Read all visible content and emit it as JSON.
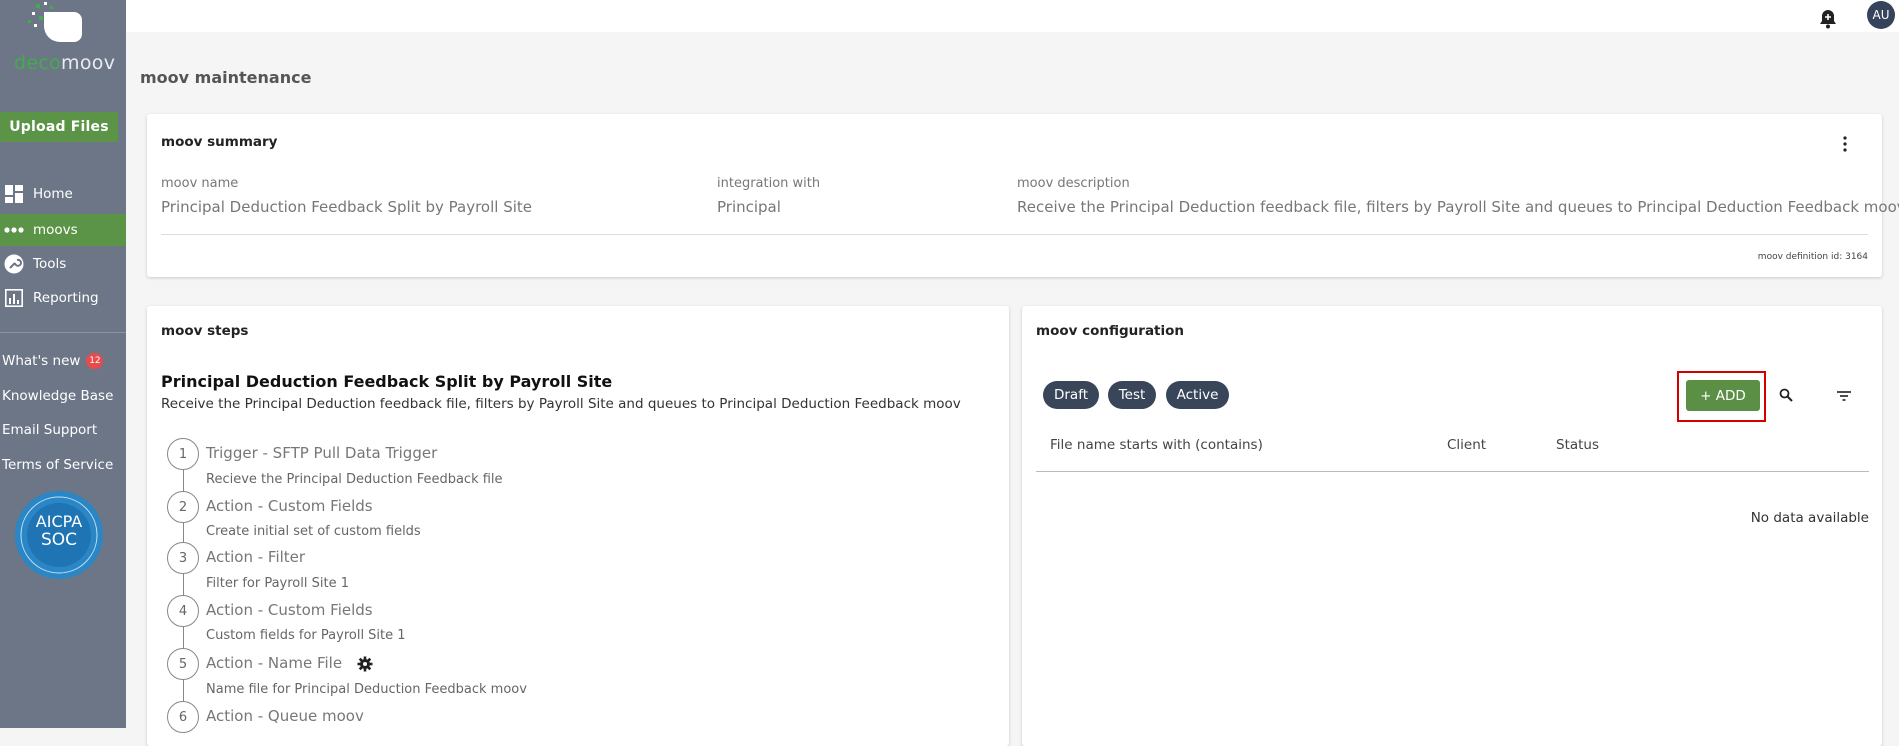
{
  "logo": {
    "text_a": "deco",
    "text_b": "moov"
  },
  "sidebar": {
    "upload_label": "Upload Files",
    "nav": [
      {
        "label": "Home",
        "icon": "dashboard-icon"
      },
      {
        "label": "moovs",
        "icon": "dots-icon"
      },
      {
        "label": "Tools",
        "icon": "wrench-icon"
      },
      {
        "label": "Reporting",
        "icon": "chart-icon"
      }
    ],
    "links": [
      {
        "label": "What's new",
        "badge": "12"
      },
      {
        "label": "Knowledge Base"
      },
      {
        "label": "Email Support"
      },
      {
        "label": "Terms of Service"
      }
    ],
    "cert": {
      "line1": "AICPA",
      "line2": "SOC"
    }
  },
  "topbar": {
    "avatar": "AU"
  },
  "page_title": "moov maintenance",
  "summary": {
    "title": "moov summary",
    "name_label": "moov name",
    "name_value": "Principal Deduction Feedback Split by Payroll Site",
    "integration_label": "integration with",
    "integration_value": "Principal",
    "desc_label": "moov description",
    "desc_value": "Receive the Principal Deduction feedback file, filters by Payroll Site and queues to Principal Deduction Feedback moov",
    "definition_id": "moov definition id: 3164"
  },
  "steps": {
    "card_title": "moov steps",
    "title": "Principal Deduction Feedback Split by Payroll Site",
    "description": "Receive the Principal Deduction feedback file, filters by Payroll Site and queues to Principal Deduction Feedback moov",
    "items": [
      {
        "num": "1",
        "title": "Trigger - SFTP Pull Data Trigger",
        "sub": "Recieve the Principal Deduction Feedback file"
      },
      {
        "num": "2",
        "title": "Action - Custom Fields",
        "sub": "Create initial set of custom fields"
      },
      {
        "num": "3",
        "title": "Action - Filter",
        "sub": "Filter for Payroll Site 1"
      },
      {
        "num": "4",
        "title": "Action - Custom Fields",
        "sub": "Custom fields for Payroll Site 1"
      },
      {
        "num": "5",
        "title": "Action - Name File",
        "sub": "Name file for Principal Deduction Feedback moov"
      },
      {
        "num": "6",
        "title": "Action - Queue moov",
        "sub": ""
      }
    ]
  },
  "config": {
    "title": "moov configuration",
    "chips": [
      "Draft",
      "Test",
      "Active"
    ],
    "add_label": "+ ADD",
    "columns": [
      "File name starts with (contains)",
      "Client",
      "Status"
    ],
    "empty": "No data available"
  },
  "colors": {
    "sidebar": "#6c7686",
    "accent_green": "#5b9447",
    "chip": "#39465a",
    "highlight": "#d40000"
  }
}
